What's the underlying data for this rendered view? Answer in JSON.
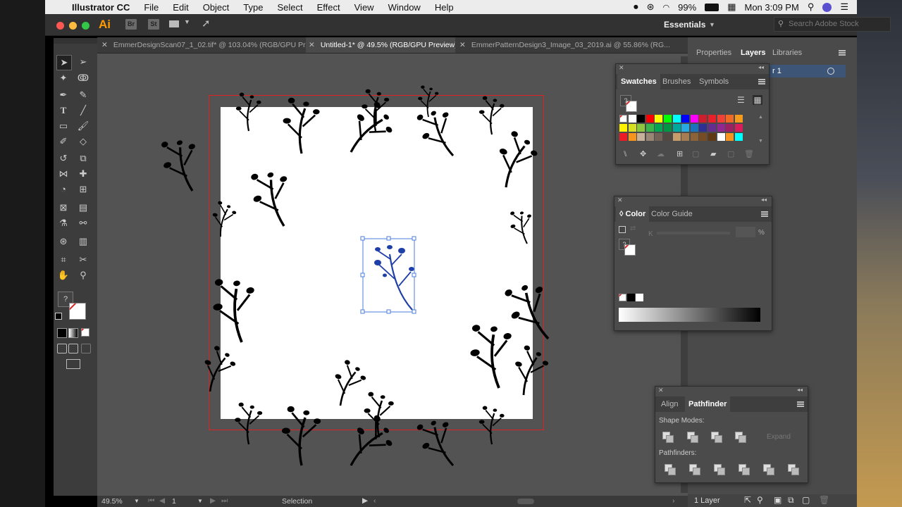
{
  "mac_menubar": {
    "app_name": "Illustrator CC",
    "menus": [
      "File",
      "Edit",
      "Object",
      "Type",
      "Select",
      "Effect",
      "View",
      "Window",
      "Help"
    ],
    "battery": "99%",
    "clock": "Mon 3:09 PM"
  },
  "appbar": {
    "logo": "Ai",
    "bridge": "Br",
    "stock": "St",
    "workspace": "Essentials",
    "search_placeholder": "Search Adobe Stock"
  },
  "doc_tabs": [
    {
      "label": "EmmerDesignScan07_1_02.tif* @ 103.04% (RGB/GPU Pr...",
      "active": false
    },
    {
      "label": "Untitled-1* @ 49.5% (RGB/GPU Preview)",
      "active": true
    },
    {
      "label": "EmmerPatternDesign3_Image_03_2019.ai @ 55.86% (RG...",
      "active": false
    }
  ],
  "statusbar": {
    "zoom": "49.5%",
    "artboard": "1",
    "tool": "Selection"
  },
  "right_dock": {
    "tabs": [
      "Properties",
      "Layers",
      "Libraries"
    ],
    "active_tab": "Layers",
    "layer_partial": "r 1",
    "footer": "1 Layer"
  },
  "swatches_panel": {
    "tabs": [
      "Swatches",
      "Brushes",
      "Symbols"
    ],
    "active_tab": "Swatches",
    "row1": [
      "#ffffff",
      "#ffffff",
      "#000000",
      "#ff0000",
      "#ffff00",
      "#00ff00",
      "#00ffff",
      "#0000ff",
      "#ff00ff",
      "#cc1e2c",
      "#e8202a",
      "#ef4135",
      "#f06a23",
      "#f59b1e"
    ],
    "row2": [
      "#fff200",
      "#d7df23",
      "#8dc63f",
      "#39b54a",
      "#00a651",
      "#009444",
      "#00a79d",
      "#27aae1",
      "#1c75bc",
      "#2e3192",
      "#662d91",
      "#92278f",
      "#9e1f63",
      "#da1c5c"
    ],
    "row3": [
      "#ed1c24",
      "#f7941d",
      "#c7b299",
      "#998675",
      "#736357",
      "#534741",
      "#c69c6d",
      "#a67c52",
      "#8c6239",
      "#754c24",
      "#603813",
      "#ffffff",
      "#f7941d",
      "#00ffff"
    ]
  },
  "color_panel": {
    "tabs": [
      "Color",
      "Color Guide"
    ],
    "active_tab": "Color",
    "channel_label": "K",
    "unit": "%"
  },
  "pathfinder_panel": {
    "tabs": [
      "Align",
      "Pathfinder"
    ],
    "active_tab": "Pathfinder",
    "shape_modes_label": "Shape Modes:",
    "pathfinders_label": "Pathfinders:",
    "expand_label": "Expand"
  }
}
